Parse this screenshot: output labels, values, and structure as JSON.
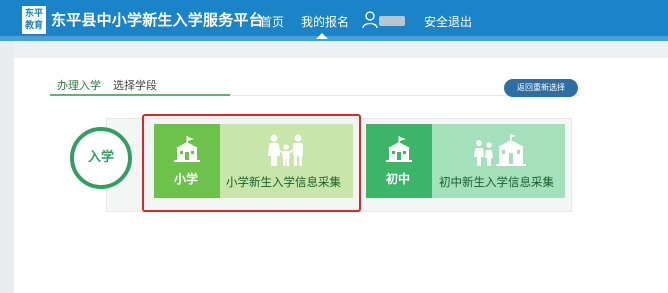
{
  "header": {
    "logo_text": "东平\n教育",
    "site_title": "东平县中小学新生入学服务平台",
    "nav": {
      "home": "首页",
      "my_registration": "我的报名",
      "logout": "安全退出"
    },
    "icons": {
      "user": "user-icon"
    }
  },
  "tabs": {
    "active": "办理入学",
    "second": "选择学段"
  },
  "actions": {
    "reset_label": "返回重新选择"
  },
  "enroll": {
    "circle_label": "入学"
  },
  "cards": {
    "primary": {
      "short_label": "小学",
      "long_label": "小学新生入学信息采集",
      "icons": [
        "school-icon",
        "family-icon"
      ]
    },
    "middle": {
      "short_label": "初中",
      "long_label": "初中新生入学信息采集",
      "icons": [
        "school-icon",
        "students-icon"
      ]
    }
  },
  "colors": {
    "header_blue": "#1b84c9",
    "primary_dark": "#6cc24a",
    "primary_light": "#c8e6a9",
    "middle_dark": "#3db569",
    "middle_light": "#a5e0bd",
    "highlight_red": "#e22424"
  }
}
